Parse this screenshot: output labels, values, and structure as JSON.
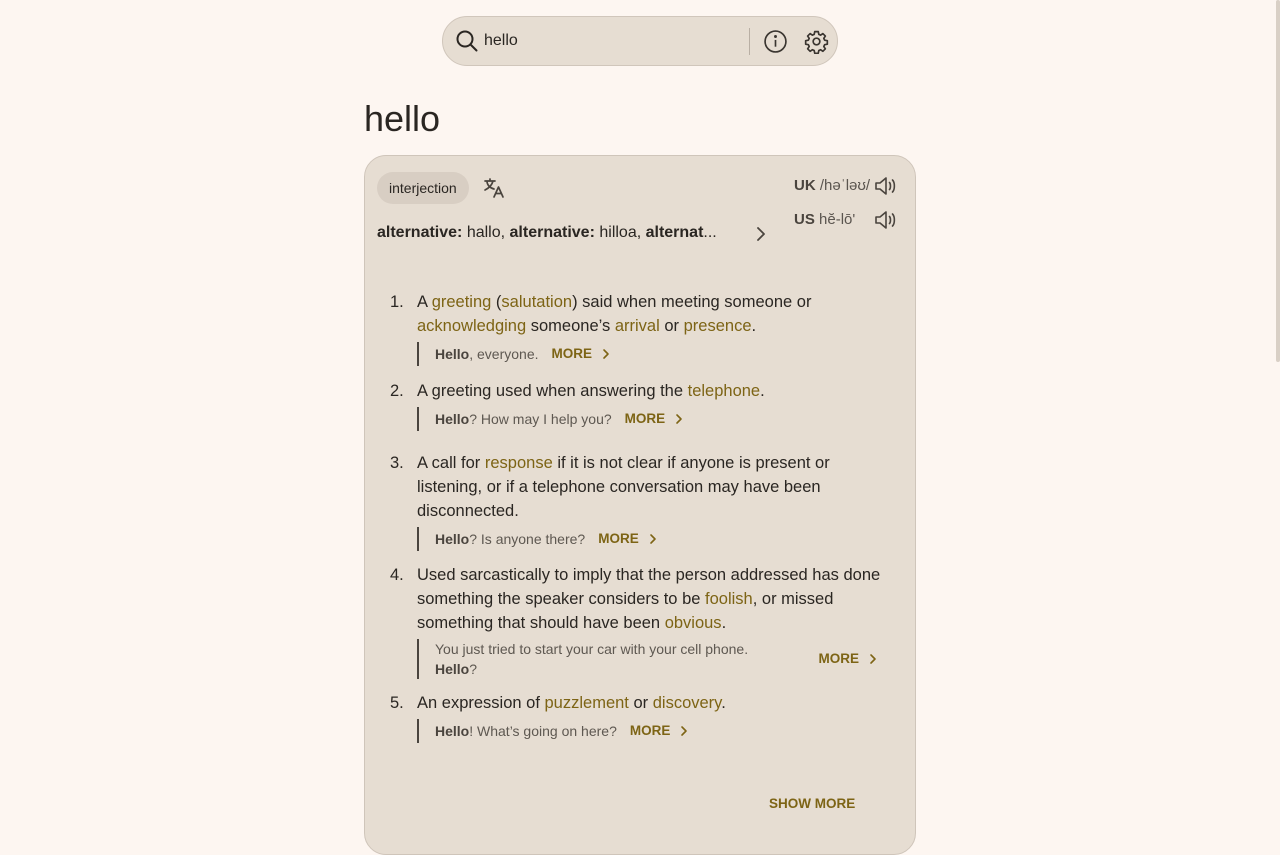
{
  "search": {
    "value": "hello"
  },
  "page_title": "hello",
  "entry": {
    "part_of_speech": "interjection",
    "alternatives": [
      {
        "label": "alternative:",
        "word": "hallo"
      },
      {
        "label": "alternative:",
        "word": "hilloa"
      },
      {
        "label": "alternat",
        "word": "..."
      }
    ],
    "pronunciations": [
      {
        "region": "UK",
        "ipa": "/həˈləʊ/"
      },
      {
        "region": "US",
        "ipa": "hĕ-lō'"
      }
    ],
    "definitions": [
      {
        "num": "1.",
        "parts": [
          {
            "t": "A "
          },
          {
            "t": "greeting",
            "link": true
          },
          {
            "t": " ("
          },
          {
            "t": "salutation",
            "link": true
          },
          {
            "t": ") said when meeting someone or "
          },
          {
            "t": "acknowledging",
            "link": true
          },
          {
            "t": " someone’s "
          },
          {
            "t": "arrival",
            "link": true
          },
          {
            "t": " or "
          },
          {
            "t": "presence",
            "link": true
          },
          {
            "t": "."
          }
        ],
        "example_bold": "Hello",
        "example_rest": ", everyone.",
        "more": "MORE"
      },
      {
        "num": "2.",
        "parts": [
          {
            "t": "A greeting used when answering the "
          },
          {
            "t": "telephone",
            "link": true
          },
          {
            "t": "."
          }
        ],
        "example_bold": "Hello",
        "example_rest": "? How may I help you?",
        "more": "MORE"
      },
      {
        "num": "3.",
        "parts": [
          {
            "t": "A call for "
          },
          {
            "t": "response",
            "link": true
          },
          {
            "t": " if it is not clear if anyone is present or listening, or if a telephone conversation may have been disconnected."
          }
        ],
        "example_bold": "Hello",
        "example_rest": "? Is anyone there?",
        "more": "MORE"
      },
      {
        "num": "4.",
        "parts": [
          {
            "t": "Used sarcastically to imply that the person addressed has done something the speaker considers to be "
          },
          {
            "t": "foolish",
            "link": true
          },
          {
            "t": ", or missed something that should have been "
          },
          {
            "t": "obvious",
            "link": true
          },
          {
            "t": "."
          }
        ],
        "example_pre": "You just tried to start your car with your cell phone.",
        "example_bold": "Hello",
        "example_rest": "?",
        "more": "MORE"
      },
      {
        "num": "5.",
        "parts": [
          {
            "t": "An expression of "
          },
          {
            "t": "puzzlement",
            "link": true
          },
          {
            "t": " or "
          },
          {
            "t": "discovery",
            "link": true
          },
          {
            "t": "."
          }
        ],
        "example_bold": "Hello",
        "example_rest": "! What’s going on here?",
        "more": "MORE"
      }
    ],
    "show_more": "SHOW MORE"
  }
}
